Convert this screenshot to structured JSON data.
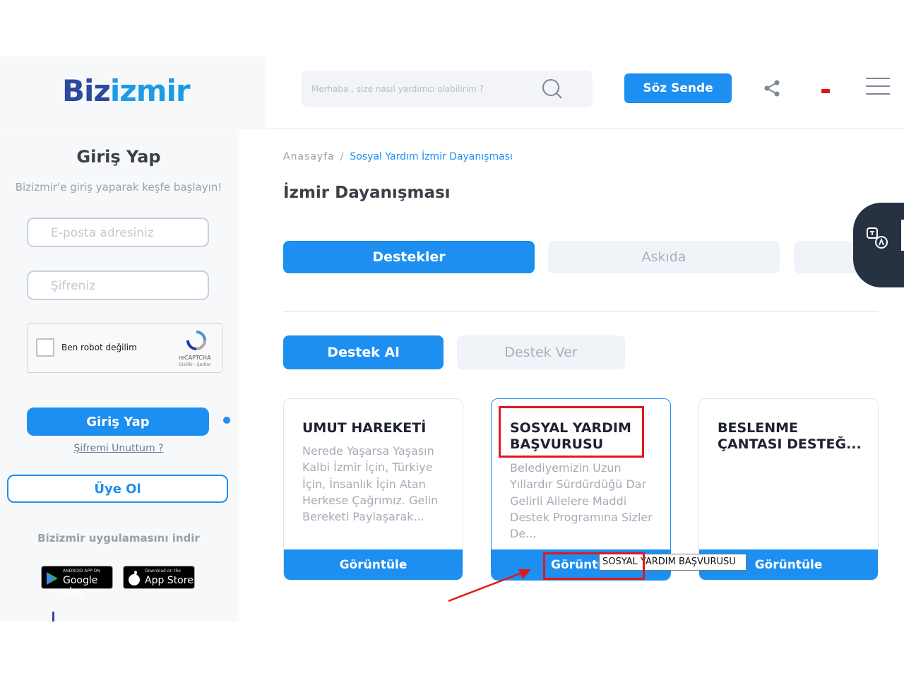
{
  "header": {
    "logo_part1": "Biz",
    "logo_part2": "izmir",
    "search_placeholder": "Merhaba , size nasıl yardımcı olabilirim ?",
    "soz_button": "Söz Sende"
  },
  "sidebar": {
    "title": "Giriş Yap",
    "subtitle": "Bizizmir'e giriş yaparak keşfe başlayın!",
    "email_placeholder": "E-posta adresiniz",
    "password_placeholder": "Şifreniz",
    "captcha_label": "Ben robot değilim",
    "captcha_brand": "reCAPTCHA",
    "captcha_links": "Gizlilik - Şartlar",
    "login_button": "Giriş Yap",
    "forgot_link": "Şifremi Unuttum ?",
    "register_button": "Üye Ol",
    "app_title": "Bizizmir uygulamasını indir",
    "google_play_small": "ANDROID APP ON",
    "google_play_label": "Google play",
    "app_store_small": "Download on the",
    "app_store_label": "App Store"
  },
  "breadcrumb": {
    "home": "Anasayfa",
    "separator": "/",
    "current": "Sosyal Yardım İzmir Dayanışması"
  },
  "page_title": "İzmir Dayanışması",
  "tabs": [
    {
      "label": "Destekler",
      "active": true
    },
    {
      "label": "Askıda",
      "active": false
    },
    {
      "label": "",
      "active": false
    }
  ],
  "subtabs": [
    {
      "label": "Destek Al",
      "active": true
    },
    {
      "label": "Destek Ver",
      "active": false
    }
  ],
  "cards": [
    {
      "title": "UMUT HAREKETİ",
      "description": "Nerede Yaşarsa Yaşasın Kalbi İzmir İçin, Türkiye İçin, İnsanlık İçin Atan Herkese Çağrımız. Gelin Bereketi Paylaşarak...",
      "button": "Görüntüle"
    },
    {
      "title": "SOSYAL YARDIM BAŞVURUSU",
      "description": "Belediyemizin Uzun Yıllardır Sürdürdüğü Dar Gelirli Ailelere Maddi Destek Programına Sizler De...",
      "button": "Görüntüle"
    },
    {
      "title": "BESLENME ÇANTASI DESTEĞ...",
      "description": "",
      "button": "Görüntüle"
    }
  ],
  "tooltip": "SOSYAL YARDIM BAŞVURUSU",
  "colors": {
    "primary": "#1c8ff0",
    "logo_dark": "#2c4a9e",
    "annotation_red": "#e0181e",
    "a11y_panel": "#263142"
  },
  "icons": [
    "search-icon",
    "share-icon",
    "flag-icon",
    "menu-icon",
    "recaptcha-icon",
    "google-play-icon",
    "apple-icon",
    "translate-icon",
    "arrow-annotation"
  ]
}
